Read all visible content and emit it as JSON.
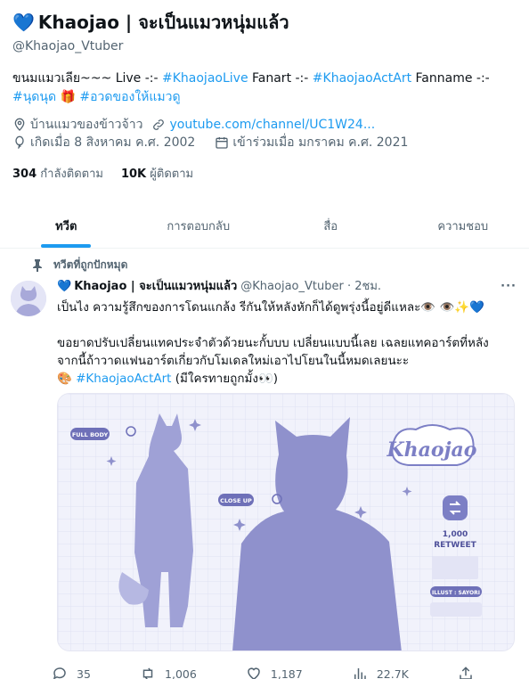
{
  "profile": {
    "name": "Khaojao | จะเป็นแมวหนุ่มแล้ว",
    "handle": "@Khaojao_Vtuber",
    "bio": {
      "t1": "ขนมแมวเลีย~~~ Live -:- ",
      "h1": "#KhaojaoLive",
      "t2": " Fanart -:- ",
      "h2": "#KhaojaoActArt",
      "t3": " Fanname -:- ",
      "h3": "#นุดนุด",
      "gift": "🎁",
      "h4": "#อวดของให้แมวดู"
    },
    "location": "บ้านแมวของข้าวจ้าว",
    "website": "youtube.com/channel/UC1W24...",
    "birthday": "เกิดเมื่อ 8 สิงหาคม ค.ศ. 2002",
    "joined": "เข้าร่วมเมื่อ มกราคม ค.ศ. 2021",
    "following_count": "304",
    "following_label": "กำลังติดตาม",
    "followers_count": "10K",
    "followers_label": "ผู้ติดตาม"
  },
  "tabs": [
    {
      "label": "ทวีต"
    },
    {
      "label": "การตอบกลับ"
    },
    {
      "label": "สื่อ"
    },
    {
      "label": "ความชอบ"
    }
  ],
  "tweet": {
    "pinned_label": "ทวีตที่ถูกปักหมุด",
    "name": "Khaojao | จะเป็นแมวหนุ่มแล้ว",
    "handle_time": "@Khaojao_Vtuber · 2ชม.",
    "more": "···",
    "line1": "เป็นไง ความรู้สึกของการโดนแกล้ง รีกันให้หลังหักก็ได้ดูพรุ่งนี้อยู่ดีแหละ👁️ 👁️✨💙",
    "line2": "ขอยาดปรับเปลี่ยนแทคประจำตัวด้วยนะกั้บบบ เปลี่ยนแบบนี้เลย เฉลยแทคอาร์ตที่หลัง",
    "line3": "จากนี้ถ้าวาดแฟนอาร์ตเกี่ยวกับโมเดลใหม่เอาไปโยนในนี้หมดเลยนะะ",
    "palette": "🎨",
    "hashtag": "#KhaojaoActArt",
    "tail": " (มีใครทายถูกมั้ง👀)",
    "media": {
      "full_body": "FULL BODY",
      "close_up": "CLOSE UP",
      "logo": "Khaojao",
      "rt_count": "1,000",
      "rt_label": "RETWEET",
      "illust": "ILLUST : SAYORI"
    },
    "stats": {
      "replies": "35",
      "retweets": "1,006",
      "likes": "1,187",
      "views": "22.7K"
    }
  }
}
